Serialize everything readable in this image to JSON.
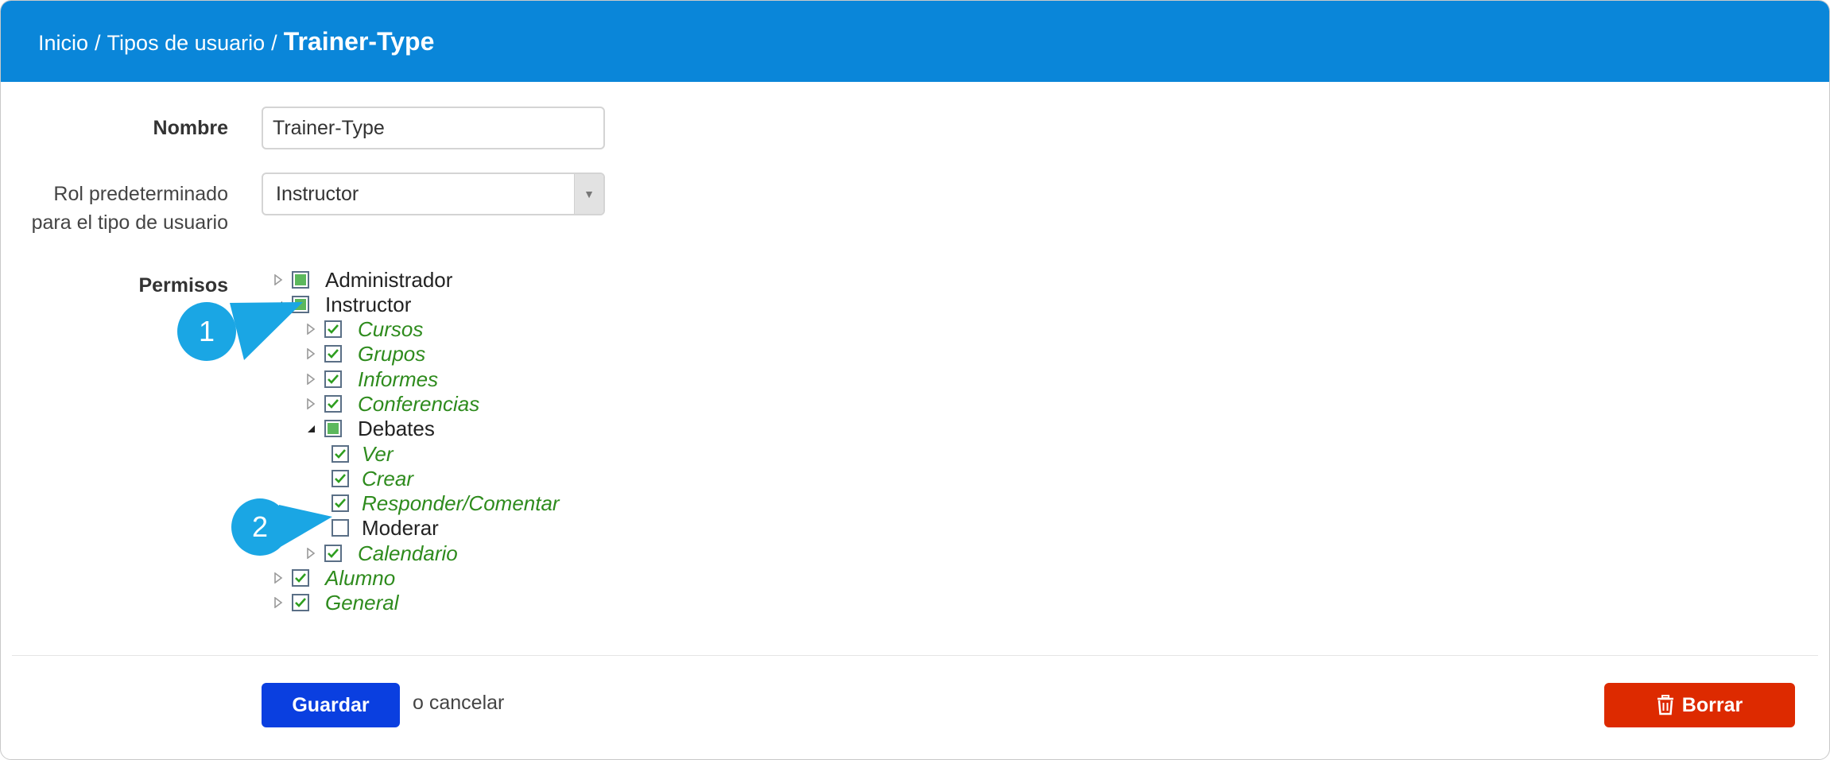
{
  "breadcrumb": {
    "home": "Inicio",
    "separator": "/",
    "section": "Tipos de usuario",
    "current": "Trainer-Type"
  },
  "form": {
    "name_label": "Nombre",
    "name_value": "Trainer-Type",
    "role_label_line1": "Rol predeterminado",
    "role_label_line2": "para el tipo de usuario",
    "role_value": "Instructor",
    "permissions_label": "Permisos"
  },
  "tree": [
    {
      "label": "Administrador",
      "state": "partial",
      "toggle": "collapsed"
    },
    {
      "label": "Instructor",
      "state": "partial",
      "toggle": "expanded"
    },
    {
      "label": "Cursos",
      "state": "checked",
      "toggle": "collapsed"
    },
    {
      "label": "Grupos",
      "state": "checked",
      "toggle": "collapsed"
    },
    {
      "label": "Informes",
      "state": "checked",
      "toggle": "collapsed"
    },
    {
      "label": "Conferencias",
      "state": "checked",
      "toggle": "collapsed"
    },
    {
      "label": "Debates",
      "state": "partial",
      "toggle": "expanded"
    },
    {
      "label": "Ver",
      "state": "checked",
      "toggle": "none"
    },
    {
      "label": "Crear",
      "state": "checked",
      "toggle": "none"
    },
    {
      "label": "Responder/Comentar",
      "state": "checked",
      "toggle": "none"
    },
    {
      "label": "Moderar",
      "state": "unchecked",
      "toggle": "none"
    },
    {
      "label": "Calendario",
      "state": "checked",
      "toggle": "collapsed"
    },
    {
      "label": "Alumno",
      "state": "checked",
      "toggle": "collapsed"
    },
    {
      "label": "General",
      "state": "checked",
      "toggle": "collapsed"
    }
  ],
  "callouts": [
    "1",
    "2"
  ],
  "actions": {
    "save": "Guardar",
    "or_cancel_prefix": "o",
    "cancel": "cancelar",
    "delete": "Borrar"
  },
  "colors": {
    "header": "#0a86d9",
    "checked_text": "#2e8b1d",
    "checkbox_fill": "#5cb85c",
    "save_button": "#0a3fe0",
    "delete_button": "#dd2a00",
    "callout": "#1aa6e4"
  },
  "icons": {
    "collapsed": "triangle-right-outline-icon",
    "expanded": "triangle-down-filled-icon",
    "delete": "trash-icon"
  }
}
